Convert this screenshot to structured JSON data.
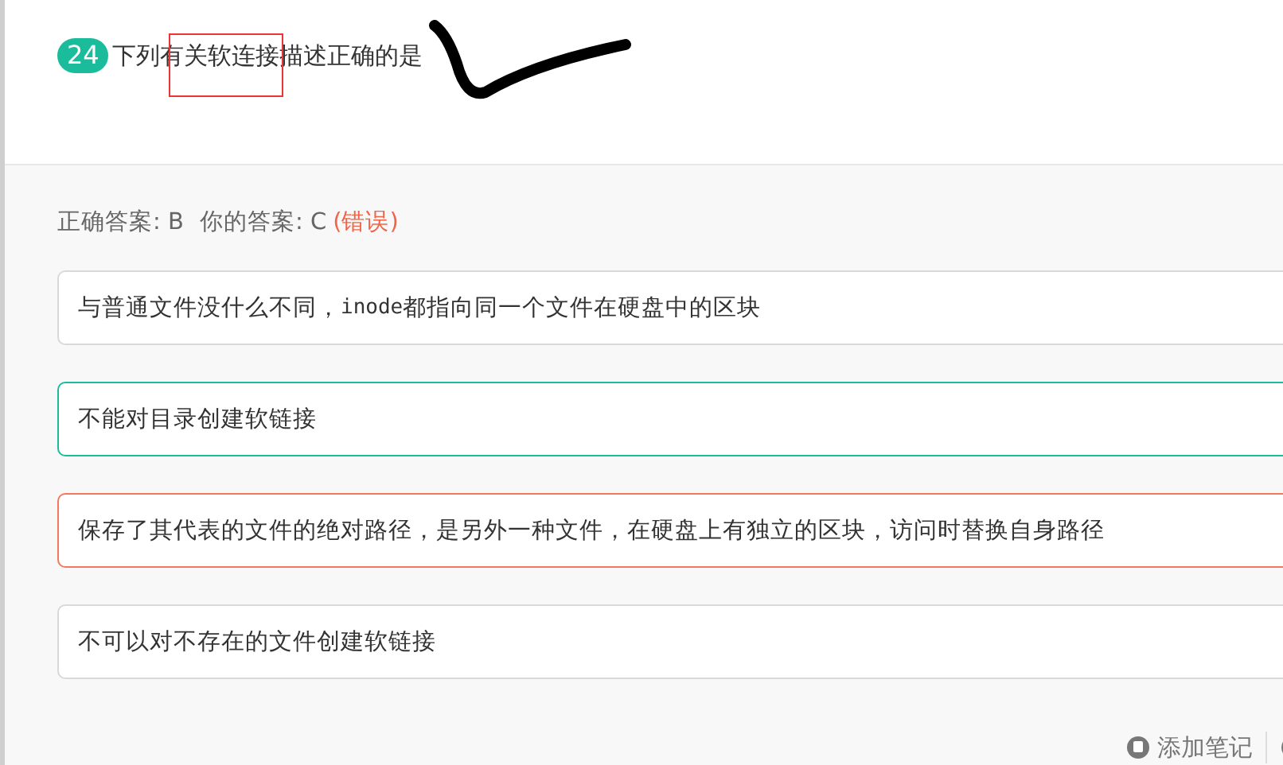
{
  "question": {
    "number": "24",
    "text": "下列有关软连接描述正确的是"
  },
  "result": {
    "correct_answer": "正确答案: B",
    "your_answer": "你的答案: C",
    "verdict": "(错误)",
    "wrong": true
  },
  "options": [
    {
      "kind": "normal",
      "segments": [
        {
          "text": "与普通文件没什么不同，",
          "code": false
        },
        {
          "text": "inode",
          "code": true
        },
        {
          "text": " 都指向同一个文件在硬盘中的区块",
          "code": false
        }
      ]
    },
    {
      "kind": "correct",
      "segments": [
        {
          "text": "不能对目录创建软链接",
          "code": false
        }
      ]
    },
    {
      "kind": "wrong",
      "segments": [
        {
          "text": "保存了其代表的文件的绝对路径，是另外一种文件，在硬盘上有独立的区块，访问时替换自身路径",
          "code": false
        }
      ]
    },
    {
      "kind": "normal",
      "segments": [
        {
          "text": "不可以对不存在的文件创建软链接",
          "code": false
        }
      ]
    }
  ],
  "footer": {
    "add_note": "添加笔记"
  }
}
